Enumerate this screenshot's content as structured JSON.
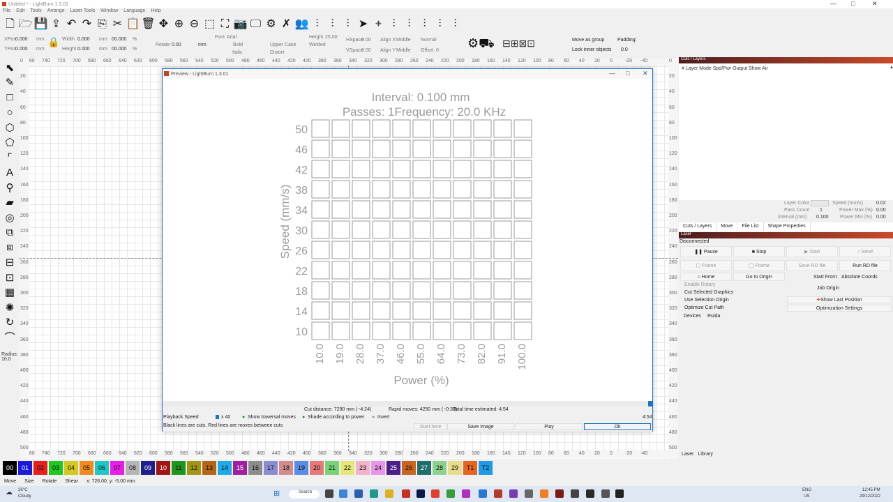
{
  "window": {
    "title": "Untitled * - LightBurn 1.3.01"
  },
  "menu": [
    "File",
    "Edit",
    "Tools",
    "Arrange",
    "Laser Tools",
    "Window",
    "Language",
    "Help"
  ],
  "toolbar_icons": [
    "new-file-icon",
    "open-folder-icon",
    "save-icon",
    "import-icon",
    "undo-icon",
    "redo-icon",
    "copy-icon",
    "cut-icon",
    "paste-icon",
    "delete-icon",
    "move-icon",
    "zoom-in-icon",
    "zoom-out-icon",
    "zoom-frame-icon",
    "zoom-select-icon",
    "camera-icon",
    "monitor-icon",
    "settings-gear-icon",
    "tools-wrench-icon",
    "users-icon",
    "align-icon",
    "align-icon",
    "align-icon",
    "send-icon",
    "target-icon",
    "align-icon",
    "align-icon",
    "align-icon",
    "align-icon",
    "align-icon"
  ],
  "props": {
    "xpos_label": "XPos",
    "xpos": "0.000",
    "ypos_label": "YPos",
    "ypos": "0.000",
    "unit": "mm",
    "width_label": "Width",
    "width": "0.000",
    "height_label": "Height",
    "height": "0.000",
    "pct_w": "00.000",
    "pct_h": "00.000",
    "pct": "%",
    "rotate_label": "Rotate",
    "rotate": "0.00",
    "unit2": "mm",
    "font_label": "Font",
    "font": "Arial",
    "bold": "Bold",
    "italic": "Italic",
    "upper_case": "Upper Case",
    "distort": "Distort",
    "welded": "Welded",
    "text_height_label": "Height",
    "text_height": "25.00",
    "hspace_label": "HSpace",
    "hspace": "0.00",
    "vspace_label": "VSpace",
    "vspace": "0.00",
    "align_x_label": "Align X",
    "align_x": "Middle",
    "align_y_label": "Align Y",
    "align_y": "Middle",
    "normal": "Normal",
    "offset_label": "Offset",
    "offset": "0",
    "move_as_group": "Move as group",
    "lock_inner": "Lock inner objects",
    "padding_label": "Padding:",
    "padding": "0.0"
  },
  "radius": {
    "label": "Radius:",
    "value": "10.0"
  },
  "rulers": {
    "top": [
      "760",
      "740",
      "720",
      "700",
      "680",
      "660",
      "640",
      "620",
      "600",
      "580",
      "560",
      "540",
      "520",
      "500",
      "480",
      "460",
      "440",
      "420",
      "400",
      "380",
      "360",
      "340",
      "320",
      "300",
      "280",
      "260",
      "240",
      "220",
      "200",
      "180",
      "160",
      "140",
      "120",
      "100",
      "80",
      "60",
      "40",
      "20",
      "0",
      "-20",
      "-40"
    ],
    "side": [
      "0",
      "20",
      "40",
      "60",
      "80",
      "100",
      "120",
      "140",
      "160",
      "180",
      "200",
      "220",
      "240",
      "260",
      "280",
      "300",
      "320",
      "340",
      "360",
      "380",
      "400",
      "420",
      "440",
      "460",
      "480",
      "500"
    ]
  },
  "preview": {
    "title": "Preview - LightBurn 1.3.01",
    "interval_text": "Interval:  0.100 mm",
    "passes_text": "Passes:  1Frequency:  20.0 KHz",
    "y_label": "Speed (mm/s)",
    "x_label": "Power (%)",
    "speeds": [
      "50",
      "46",
      "42",
      "38",
      "34",
      "30",
      "26",
      "22",
      "18",
      "14",
      "10"
    ],
    "powers": [
      "10.0",
      "19.0",
      "28.0",
      "37.0",
      "46.0",
      "55.0",
      "64.0",
      "73.0",
      "82.0",
      "91.0",
      "100.0"
    ],
    "cut_distance": "Cut distance: 7290 mm (~4:24)",
    "rapid_moves": "Rapid moves: 4250 mm (~0:30)",
    "total_time": "Total time estimated: 4:54",
    "time_right": "4:54",
    "playback_speed": "Playback Speed",
    "speed_mult": "x 40",
    "show_traversal": "Show traversal moves",
    "shade_power": "Shade according to power",
    "invert": "Invert",
    "legend": "Black lines are cuts, Red lines are moves between cuts",
    "start_here": "Start here",
    "save_image": "Save Image",
    "play": "Play",
    "ok": "Ok"
  },
  "cuts": {
    "title": "Cuts / Layers",
    "columns": "#  Layer  Mode  Spd/Pwr  Output  Show  Air",
    "layer_color": "Layer Color",
    "pass_count_label": "Pass Count",
    "pass_count": "1",
    "interval_label": "Interval (mm)",
    "interval": "0.100",
    "speed_label": "Speed (mm/s)",
    "speed": "0.02",
    "power_max_label": "Power Max (%)",
    "power_max": "0.00",
    "power_min_label": "Power Min (%)",
    "power_min": "0.00",
    "tabs": [
      "Cuts / Layers",
      "Move",
      "File List",
      "Shape Properties"
    ]
  },
  "laser": {
    "title": "Laser",
    "status": "Disconnected",
    "pause": "Pause",
    "stop": "Stop",
    "start": "Start",
    "send": "Send",
    "frame1": "Frame",
    "frame2": "Frame",
    "save_rd": "Save RD file",
    "run_rd": "Run RD file",
    "home": "Home",
    "go_origin": "Go to Origin",
    "start_from_label": "Start From:",
    "start_from": "Absolute Coords",
    "enable_rotary": "Enable Rotary",
    "cut_selected": "Cut Selected Graphics",
    "use_selection_origin": "Use Selection Origin",
    "optimize_cut": "Optimize Cut Path",
    "job_origin": "Job Origin",
    "show_last_position": "Show Last Position",
    "optimization_settings": "Optimization Settings",
    "devices": "Devices",
    "device": "Ruida",
    "tabs": [
      "Laser",
      "Library"
    ]
  },
  "palette": [
    {
      "label": "00",
      "color": "#000000"
    },
    {
      "label": "01",
      "color": "#1a1adc"
    },
    {
      "label": "02",
      "color": "#e81e1e"
    },
    {
      "label": "03",
      "color": "#1ec81e"
    },
    {
      "label": "04",
      "color": "#d2c81e"
    },
    {
      "label": "05",
      "color": "#f08c1e"
    },
    {
      "label": "06",
      "color": "#1ec8c8"
    },
    {
      "label": "07",
      "color": "#e81ee8"
    },
    {
      "label": "08",
      "color": "#b4b4b4"
    },
    {
      "label": "09",
      "color": "#1e1e8c"
    },
    {
      "label": "10",
      "color": "#a01414"
    },
    {
      "label": "11",
      "color": "#1e961e"
    },
    {
      "label": "12",
      "color": "#a09614"
    },
    {
      "label": "13",
      "color": "#b46414"
    },
    {
      "label": "14",
      "color": "#1eaae6"
    },
    {
      "label": "15",
      "color": "#a01ea0"
    },
    {
      "label": "16",
      "color": "#8c8c8c"
    },
    {
      "label": "17",
      "color": "#8c8cd2"
    },
    {
      "label": "18",
      "color": "#d28c8c"
    },
    {
      "label": "19",
      "color": "#5a8ce6"
    },
    {
      "label": "20",
      "color": "#e67878"
    },
    {
      "label": "21",
      "color": "#78d278"
    },
    {
      "label": "22",
      "color": "#e6e678"
    },
    {
      "label": "23",
      "color": "#f0b4c8"
    },
    {
      "label": "24",
      "color": "#e696e6"
    },
    {
      "label": "25",
      "color": "#4b1e8c"
    },
    {
      "label": "26",
      "color": "#c8641e"
    },
    {
      "label": "27",
      "color": "#1e6e6e"
    },
    {
      "label": "28",
      "color": "#8cd28c"
    },
    {
      "label": "29",
      "color": "#e6dc8c"
    },
    {
      "label": "T1",
      "color": "#e6641e"
    },
    {
      "label": "T2",
      "color": "#1e9ae6"
    }
  ],
  "status": {
    "move": "Move",
    "size": "Size",
    "rotate": "Rotate",
    "shear": "Shear",
    "coords": "x: 726.00, y: -5.00 mm"
  },
  "taskbar": {
    "weather_temp": "26°C",
    "weather_text": "Cloudy",
    "search": "Search",
    "lang": "ENG",
    "region": "US",
    "time": "12:45 PM",
    "date": "29/12/2022"
  }
}
